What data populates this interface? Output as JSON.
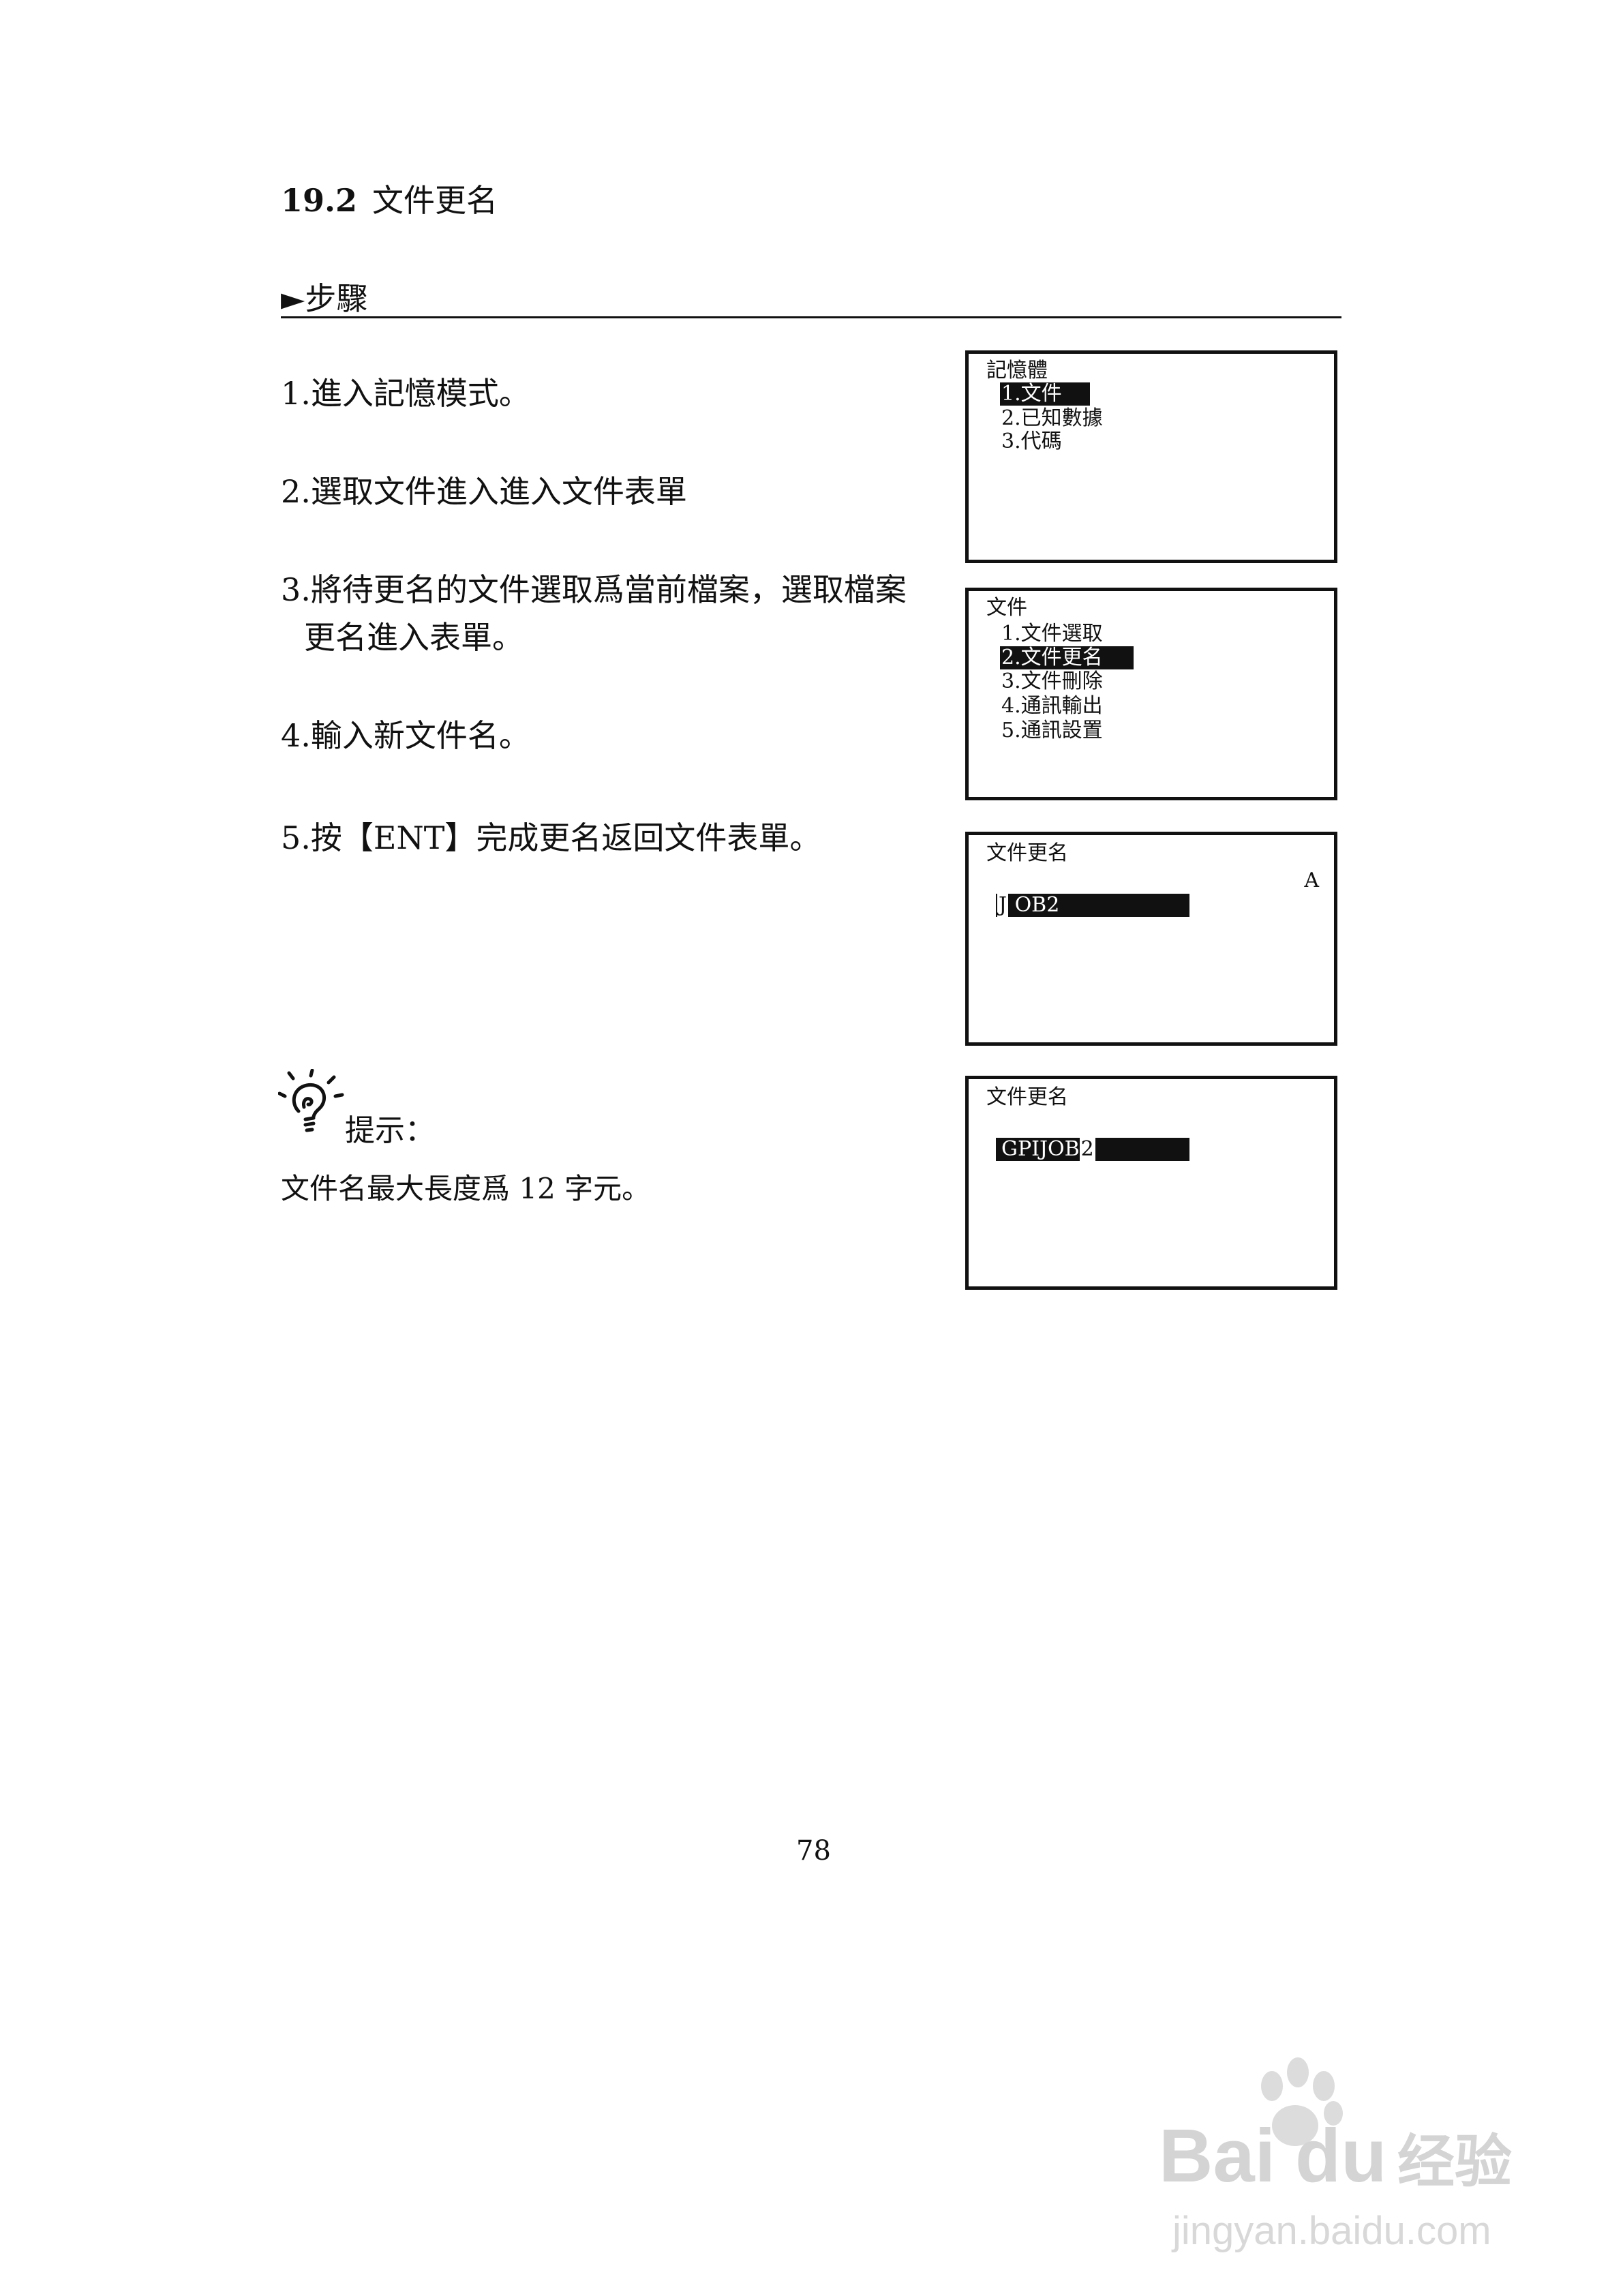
{
  "section": {
    "number": "19.2",
    "title": "文件更名"
  },
  "steps_heading": "►步驟",
  "steps": [
    "1.進入記憶模式。",
    "2.選取文件進入進入文件表單",
    "3.將待更名的文件選取爲當前檔案，選取檔案",
    "更名進入表單。",
    "4.輸入新文件名。",
    "5.按【ENT】完成更名返回文件表單。"
  ],
  "screens": {
    "memory": {
      "title": "記憶體",
      "items": [
        "1.文件",
        "2.已知數據",
        "3.代碼"
      ],
      "selected_index": 0
    },
    "file_menu": {
      "title": "文件",
      "items": [
        "1.文件選取",
        "2.文件更名",
        "3.文件刪除",
        "4.通訊輸出",
        "5.通訊設置"
      ],
      "selected_index": 1
    },
    "rename_1": {
      "title": "文件更名",
      "mode": "A",
      "field_cursor": "J",
      "field_rest": "OB2"
    },
    "rename_2": {
      "title": "文件更名",
      "field_text": "GPIJOB",
      "field_cursor": "2"
    }
  },
  "tip": {
    "label": "提示：",
    "text": "文件名最大長度爲 12 字元。"
  },
  "page_number": "78",
  "watermark": {
    "brand": "Bai",
    "brand_tail": "经验",
    "url": "jingyan.baidu.com",
    "icons": [
      "lightbulb-icon",
      "paw-icon"
    ]
  }
}
